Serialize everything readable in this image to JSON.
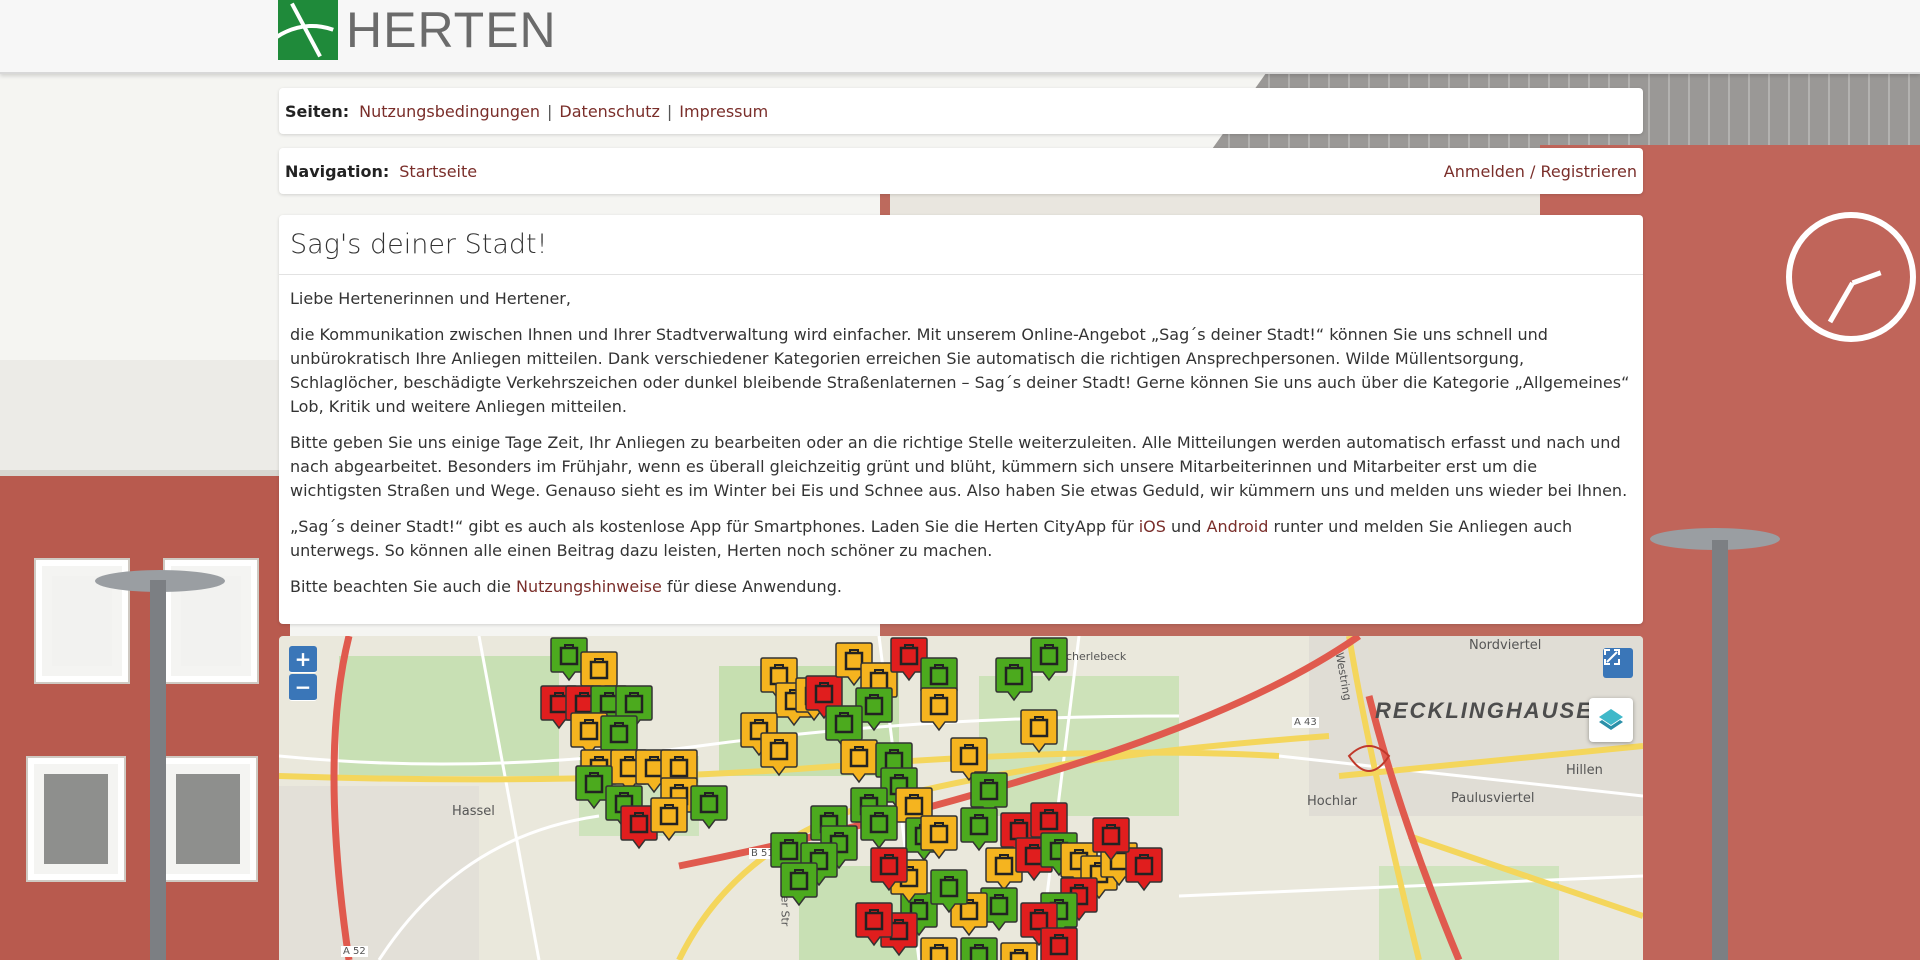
{
  "header": {
    "logo_text": "HERTEN"
  },
  "pages_bar": {
    "label": "Seiten:",
    "links": [
      "Nutzungsbedingungen",
      "Datenschutz",
      "Impressum"
    ],
    "separator": "|"
  },
  "nav_bar": {
    "label": "Navigation:",
    "start_link": "Startseite",
    "auth_link": "Anmelden / Registrieren"
  },
  "intro": {
    "title": "Sag's deiner Stadt!",
    "greeting": "Liebe Hertenerinnen und Hertener,",
    "p1": "die Kommunikation zwischen Ihnen und Ihrer Stadtverwaltung wird einfacher. Mit unserem Online-Angebot „Sag´s deiner Stadt!“ können Sie uns schnell und unbürokratisch Ihre Anliegen mitteilen. Dank verschiedener Kategorien erreichen Sie automatisch die richtigen Ansprechpersonen. Wilde Müllentsorgung, Schlaglöcher, beschädigte Verkehrszeichen oder dunkel bleibende Straßenlaternen – Sag´s deiner Stadt! Gerne können Sie uns auch über die Kategorie „Allgemeines“ Lob, Kritik und weitere Anliegen mitteilen.",
    "p2": "Bitte geben Sie uns einige Tage Zeit, Ihr Anliegen zu bearbeiten oder an die richtige Stelle weiterzuleiten. Alle Mitteilungen werden automatisch erfasst und nach und nach abgearbeitet. Besonders im Frühjahr, wenn es überall gleichzeitig grünt und blüht, kümmern sich unsere Mitarbeiterinnen und Mitarbeiter erst um die wichtigsten Straßen und Wege. Genauso sieht es im Winter bei Eis und Schnee aus. Also haben Sie etwas Geduld, wir kümmern uns und melden uns wieder bei Ihnen.",
    "p3_before": "„Sag´s deiner Stadt!“ gibt es auch als kostenlose App für Smartphones. Laden Sie die Herten CityApp für ",
    "p3_link_ios": "iOS",
    "p3_and": " und ",
    "p3_link_android": "Android",
    "p3_after": " runter und melden Sie Anliegen auch unterwegs. So können alle einen Beitrag dazu leisten, Herten noch schöner zu machen.",
    "p4_before": "Bitte beachten Sie auch die ",
    "p4_link": "Nutzungshinweise",
    "p4_after": " für diese Anwendung."
  },
  "map": {
    "zoom_in": "+",
    "zoom_out": "−",
    "labels": {
      "recklinghausen": "RECKLINGHAUSEN",
      "nordviertel": "Nordviertel",
      "scherlebeck": "Scherlebeck",
      "hillen": "Hillen",
      "paulusviertel": "Paulusviertel",
      "hochlar": "Hochlar",
      "hassel": "Hassel",
      "westring": "Westring",
      "a43": "A 43",
      "b51": "B 51",
      "a52": "A 52",
      "bochumer": "Bochumer Str"
    },
    "marker_colors": {
      "green": "#4caa1e",
      "yellow": "#f5b41f",
      "red": "#e01e1e"
    }
  }
}
